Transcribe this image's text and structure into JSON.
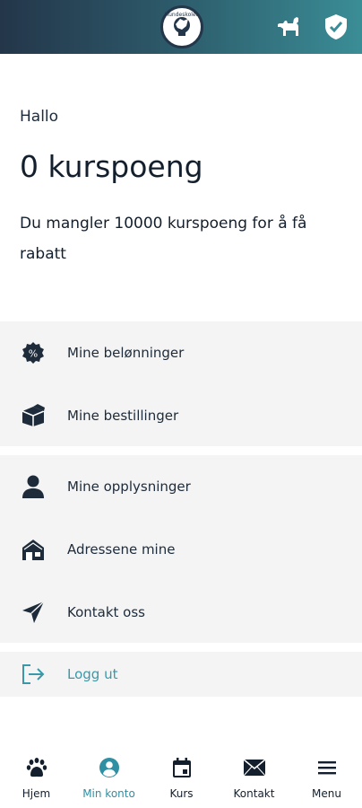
{
  "header": {
    "logo_text": "Hundeskolen",
    "icons": [
      "dog-icon",
      "shield-check-icon"
    ],
    "gradient": [
      "#24364a",
      "#3a8d96"
    ]
  },
  "greeting": "Hallo",
  "points_text": "0 kurspoeng",
  "missing_text": "Du mangler 10000 kurspoeng for å få rabatt",
  "menu": {
    "group1": [
      {
        "label": "Mine belønninger",
        "icon": "percent-badge-icon"
      },
      {
        "label": "Mine bestillinger",
        "icon": "package-icon"
      }
    ],
    "group2": [
      {
        "label": "Mine opplysninger",
        "icon": "person-icon"
      },
      {
        "label": "Adressene mine",
        "icon": "house-icon"
      },
      {
        "label": "Kontakt oss",
        "icon": "paper-plane-icon"
      }
    ],
    "logout": {
      "label": "Logg ut",
      "icon": "logout-icon"
    }
  },
  "tabs": [
    {
      "label": "Hjem",
      "icon": "paw-icon"
    },
    {
      "label": "Min konto",
      "icon": "account-icon",
      "active": true
    },
    {
      "label": "Kurs",
      "icon": "calendar-icon"
    },
    {
      "label": "Kontakt",
      "icon": "mail-icon"
    },
    {
      "label": "Menu",
      "icon": "menu-icon"
    }
  ],
  "colors": {
    "accent": "#2f8fa3",
    "text": "#1d2b3a",
    "row_bg": "#f4f4f4"
  }
}
